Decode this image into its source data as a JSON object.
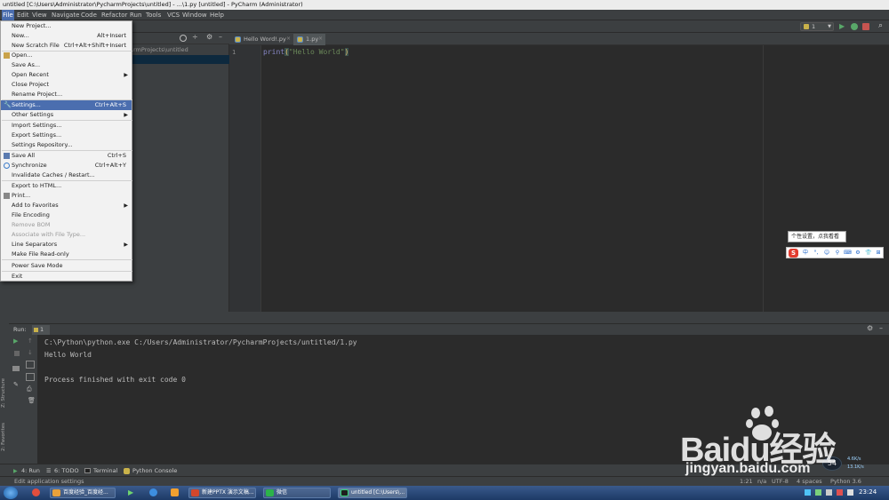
{
  "window": {
    "title": "untitled [C:\\Users\\Administrator\\PycharmProjects\\untitled] - ...\\1.py [untitled] - PyCharm (Administrator)"
  },
  "menubar": [
    "File",
    "Edit",
    "View",
    "Navigate",
    "Code",
    "Refactor",
    "Run",
    "Tools",
    "VCS",
    "Window",
    "Help"
  ],
  "toolbar": {
    "run_config": "1"
  },
  "project": {
    "path": "rmProjects\\untitled"
  },
  "editor": {
    "tabs": [
      "Hello Word!.py",
      "1.py"
    ],
    "line_number": "1",
    "code": {
      "func": "print",
      "open": "(",
      "string": "\"Hello World\"",
      "close": ")"
    }
  },
  "file_menu": [
    {
      "label": "New Project...",
      "shortcut": ""
    },
    {
      "label": "New...",
      "shortcut": "Alt+Insert"
    },
    {
      "label": "New Scratch File",
      "shortcut": "Ctrl+Alt+Shift+Insert"
    },
    {
      "label": "Open...",
      "shortcut": ""
    },
    {
      "label": "Save As...",
      "shortcut": ""
    },
    {
      "label": "Open Recent",
      "shortcut": ""
    },
    {
      "label": "Close Project",
      "shortcut": ""
    },
    {
      "label": "Rename Project...",
      "shortcut": ""
    },
    {
      "label": "Settings...",
      "shortcut": "Ctrl+Alt+S"
    },
    {
      "label": "Other Settings",
      "shortcut": ""
    },
    {
      "label": "Import Settings...",
      "shortcut": ""
    },
    {
      "label": "Export Settings...",
      "shortcut": ""
    },
    {
      "label": "Settings Repository...",
      "shortcut": ""
    },
    {
      "label": "Save All",
      "shortcut": "Ctrl+S"
    },
    {
      "label": "Synchronize",
      "shortcut": "Ctrl+Alt+Y"
    },
    {
      "label": "Invalidate Caches / Restart...",
      "shortcut": ""
    },
    {
      "label": "Export to HTML...",
      "shortcut": ""
    },
    {
      "label": "Print...",
      "shortcut": ""
    },
    {
      "label": "Add to Favorites",
      "shortcut": ""
    },
    {
      "label": "File Encoding",
      "shortcut": ""
    },
    {
      "label": "Remove BOM",
      "shortcut": ""
    },
    {
      "label": "Associate with File Type...",
      "shortcut": ""
    },
    {
      "label": "Line Separators",
      "shortcut": ""
    },
    {
      "label": "Make File Read-only",
      "shortcut": ""
    },
    {
      "label": "Power Save Mode",
      "shortcut": ""
    },
    {
      "label": "Exit",
      "shortcut": ""
    }
  ],
  "run_panel": {
    "label": "Run:",
    "tab": "1",
    "output": [
      "C:\\Python\\python.exe C:/Users/Administrator/PycharmProjects/untitled/1.py",
      "Hello World",
      "",
      "Process finished with exit code 0"
    ]
  },
  "side_labels": {
    "structure": "Z: Structure",
    "favorites": "2: Favorites"
  },
  "tool_tabs": [
    "4: Run",
    "6: TODO",
    "Terminal",
    "Python Console"
  ],
  "status": {
    "message": "Edit application settings",
    "position": "1:21",
    "line_sep": "n/a",
    "encoding": "UTF-8",
    "indent": "4 spaces",
    "interpreter": "Python 3.6"
  },
  "ime": {
    "tooltip": "个性设置，点我看看",
    "chars": [
      "中",
      "°,",
      "☺",
      "⚲",
      "⌨",
      "⚙",
      "👕",
      "⊞"
    ]
  },
  "taskbar": {
    "items": [
      "百度经验_百度经...",
      "",
      "",
      "",
      "新建PPTX 演示文稿...",
      "微信",
      "untitled [C:\\Users\\..."
    ],
    "time": "23:24"
  },
  "net_widget": {
    "percent": "54",
    "up": "4.6K/s",
    "down": "13.1K/s"
  },
  "watermark": {
    "brand": "Baidu经验",
    "url": "jingyan.baidu.com"
  }
}
